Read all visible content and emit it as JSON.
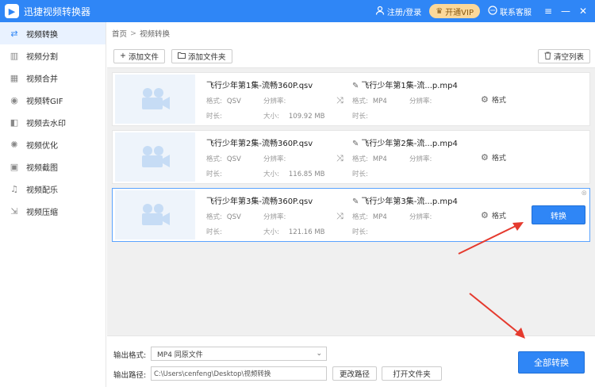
{
  "app": {
    "title": "迅捷视频转换器",
    "logo_glyph": "▶",
    "register_login": "注册/登录",
    "vip": "开通VIP",
    "contact": "联系客服"
  },
  "sidebar": {
    "items": [
      {
        "label": "视频转换",
        "icon": "convert-icon",
        "glyph": "⇄"
      },
      {
        "label": "视频分割",
        "icon": "split-icon",
        "glyph": "▥"
      },
      {
        "label": "视频合并",
        "icon": "merge-icon",
        "glyph": "▦"
      },
      {
        "label": "视频转GIF",
        "icon": "gif-icon",
        "glyph": "◉"
      },
      {
        "label": "视频去水印",
        "icon": "watermark-icon",
        "glyph": "◧"
      },
      {
        "label": "视频优化",
        "icon": "optimize-icon",
        "glyph": "✺"
      },
      {
        "label": "视频截图",
        "icon": "screenshot-icon",
        "glyph": "▣"
      },
      {
        "label": "视频配乐",
        "icon": "music-icon",
        "glyph": "♫"
      },
      {
        "label": "视频压缩",
        "icon": "compress-icon",
        "glyph": "⇲"
      }
    ]
  },
  "breadcrumb": {
    "home": "首页",
    "sep": ">",
    "current": "视频转换"
  },
  "toolbar": {
    "add_file": "添加文件",
    "add_folder": "添加文件夹",
    "clear": "清空列表"
  },
  "labels": {
    "format": "格式:",
    "resolution": "分辨率:",
    "duration": "时长:",
    "size": "大小:",
    "format_btn": "格式",
    "convert": "转换"
  },
  "files": [
    {
      "src_name": "飞行少年第1集-流畅360P.qsv",
      "src_format": "QSV",
      "src_size": "109.92 MB",
      "out_name": "飞行少年第1集-流...p.mp4",
      "out_format": "MP4"
    },
    {
      "src_name": "飞行少年第2集-流畅360P.qsv",
      "src_format": "QSV",
      "src_size": "116.85 MB",
      "out_name": "飞行少年第2集-流...p.mp4",
      "out_format": "MP4"
    },
    {
      "src_name": "飞行少年第3集-流畅360P.qsv",
      "src_format": "QSV",
      "src_size": "121.16 MB",
      "out_name": "飞行少年第3集-流...p.mp4",
      "out_format": "MP4"
    }
  ],
  "bottom": {
    "output_format_label": "输出格式:",
    "output_format_value": "MP4  同原文件",
    "output_path_label": "输出路径:",
    "output_path_value": "C:\\Users\\cenfeng\\Desktop\\视频转换",
    "change_path": "更改路径",
    "open_folder": "打开文件夹",
    "convert_all": "全部转换"
  },
  "colors": {
    "primary": "#2f86f6",
    "arrow": "#e53a2e"
  }
}
